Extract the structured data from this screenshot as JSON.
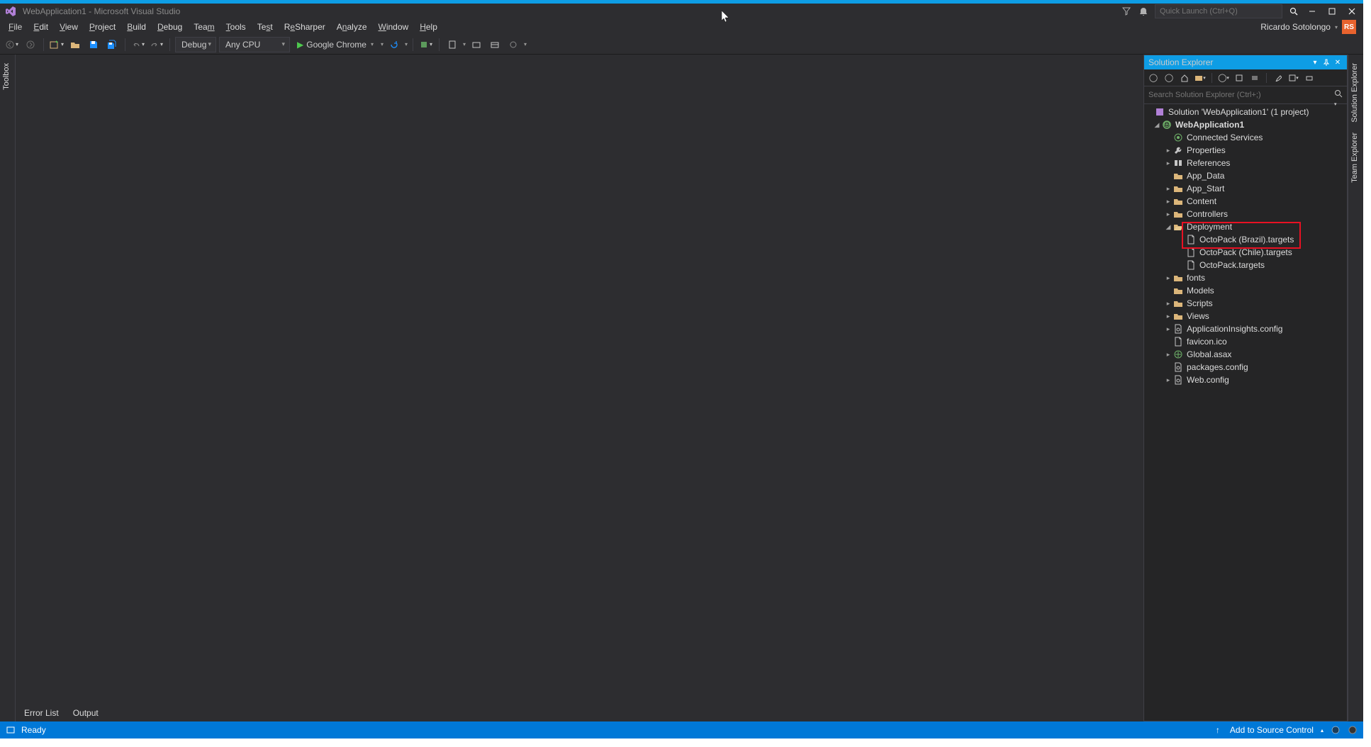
{
  "title": "WebApplication1 - Microsoft Visual Studio",
  "quicklaunch_placeholder": "Quick Launch (Ctrl+Q)",
  "menus": [
    "File",
    "Edit",
    "View",
    "Project",
    "Build",
    "Debug",
    "Team",
    "Tools",
    "Test",
    "ReSharper",
    "Analyze",
    "Window",
    "Help"
  ],
  "user": {
    "name": "Ricardo Sotolongo",
    "initials": "RS"
  },
  "toolbar": {
    "config": "Debug",
    "platform": "Any CPU",
    "run_target": "Google Chrome"
  },
  "left_tab": "Toolbox",
  "right_tabs": [
    "Solution Explorer",
    "Team Explorer"
  ],
  "bottom_tabs": [
    "Error List",
    "Output"
  ],
  "solexp": {
    "title": "Solution Explorer",
    "search_placeholder": "Search Solution Explorer (Ctrl+;)",
    "solution_label": "Solution 'WebApplication1' (1 project)",
    "project": "WebApplication1",
    "tree": [
      {
        "label": "Connected Services",
        "depth": 2,
        "arrow": "",
        "icon": "conn"
      },
      {
        "label": "Properties",
        "depth": 2,
        "arrow": "▸",
        "icon": "wrench"
      },
      {
        "label": "References",
        "depth": 2,
        "arrow": "▸",
        "icon": "ref"
      },
      {
        "label": "App_Data",
        "depth": 2,
        "arrow": "",
        "icon": "folder"
      },
      {
        "label": "App_Start",
        "depth": 2,
        "arrow": "▸",
        "icon": "folder"
      },
      {
        "label": "Content",
        "depth": 2,
        "arrow": "▸",
        "icon": "folder"
      },
      {
        "label": "Controllers",
        "depth": 2,
        "arrow": "▸",
        "icon": "folder"
      },
      {
        "label": "Deployment",
        "depth": 2,
        "arrow": "◢",
        "icon": "folder-open"
      },
      {
        "label": "OctoPack (Brazil).targets",
        "depth": 3,
        "arrow": "",
        "icon": "file",
        "hl": true
      },
      {
        "label": "OctoPack (Chile).targets",
        "depth": 3,
        "arrow": "",
        "icon": "file",
        "hl": true
      },
      {
        "label": "OctoPack.targets",
        "depth": 3,
        "arrow": "",
        "icon": "file"
      },
      {
        "label": "fonts",
        "depth": 2,
        "arrow": "▸",
        "icon": "folder"
      },
      {
        "label": "Models",
        "depth": 2,
        "arrow": "",
        "icon": "folder"
      },
      {
        "label": "Scripts",
        "depth": 2,
        "arrow": "▸",
        "icon": "folder"
      },
      {
        "label": "Views",
        "depth": 2,
        "arrow": "▸",
        "icon": "folder"
      },
      {
        "label": "ApplicationInsights.config",
        "depth": 2,
        "arrow": "▸",
        "icon": "cfg"
      },
      {
        "label": "favicon.ico",
        "depth": 2,
        "arrow": "",
        "icon": "file"
      },
      {
        "label": "Global.asax",
        "depth": 2,
        "arrow": "▸",
        "icon": "asax"
      },
      {
        "label": "packages.config",
        "depth": 2,
        "arrow": "",
        "icon": "cfg"
      },
      {
        "label": "Web.config",
        "depth": 2,
        "arrow": "▸",
        "icon": "cfg"
      }
    ]
  },
  "status": {
    "ready": "Ready",
    "add_source": "Add to Source Control"
  }
}
